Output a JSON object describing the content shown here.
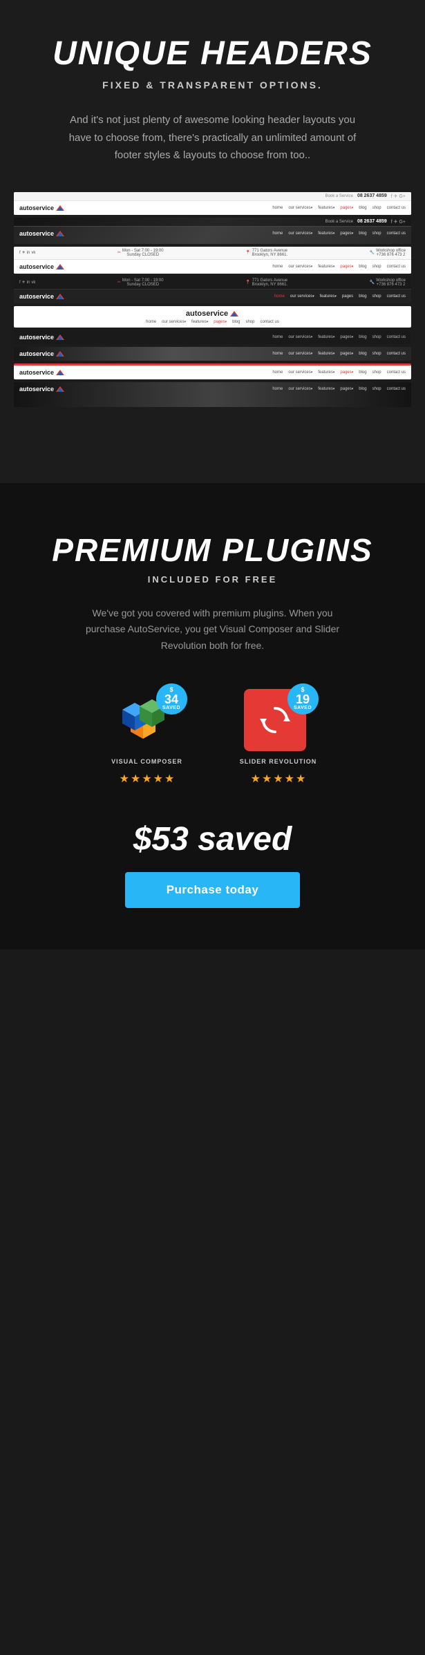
{
  "headers_section": {
    "title": "UNIQUE HEADERS",
    "subtitle": "FIXED & TRANSPARENT OPTIONS.",
    "description": "And it's not just plenty of awesome looking header layouts you have to choose from, there's practically an unlimited amount of footer styles & layouts to choose from too.."
  },
  "plugins_section": {
    "title": "PREMIUM PLUGINS",
    "subtitle": "INCLUDED FOR FREE",
    "description": "We've got you covered with premium plugins. When you purchase AutoService, you get Visual Composer and Slider Revolution both for free.",
    "plugins": [
      {
        "name": "VISUAL COMPOSER",
        "savings": "34",
        "type": "vc"
      },
      {
        "name": "SLIDER REVOLUTION",
        "savings": "19",
        "type": "sr"
      }
    ],
    "total_saved": "$53 saved",
    "purchase_label": "Purchase today"
  },
  "header_previews": [
    {
      "id": "preview-1",
      "type": "simple-top-bar"
    },
    {
      "id": "preview-2",
      "type": "dark-image"
    },
    {
      "id": "preview-3",
      "type": "info-bar"
    },
    {
      "id": "preview-4",
      "type": "info-bar-dark"
    },
    {
      "id": "preview-5",
      "type": "center-logo"
    },
    {
      "id": "preview-6",
      "type": "dark-solid"
    },
    {
      "id": "preview-7",
      "type": "img-bg"
    },
    {
      "id": "preview-8",
      "type": "red-accent"
    },
    {
      "id": "preview-9",
      "type": "img-bg-dark"
    }
  ]
}
